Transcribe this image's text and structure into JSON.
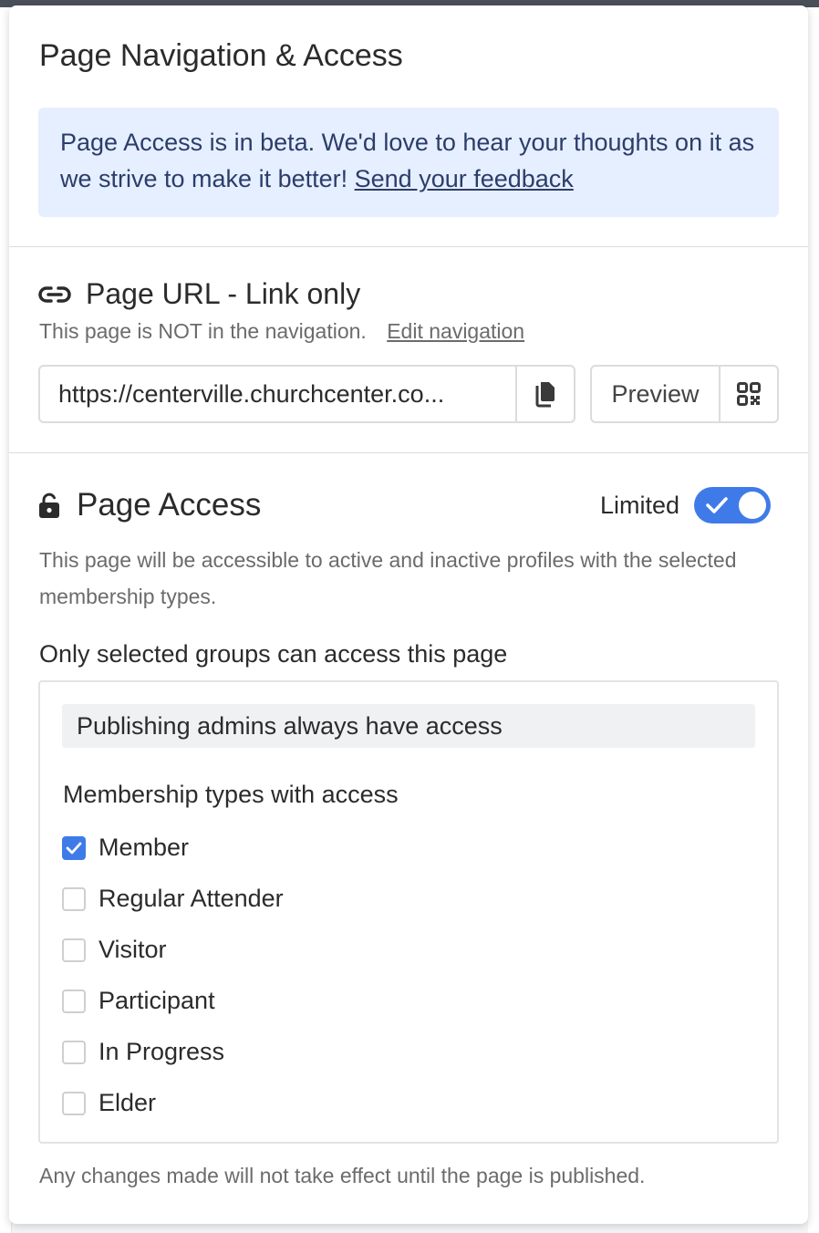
{
  "panel": {
    "title": "Page Navigation & Access",
    "beta_alert": {
      "text": "Page Access is in beta. We'd love to hear your thoughts on it as we strive to make it better!",
      "link": "Send your feedback"
    }
  },
  "page_url": {
    "title": "Page URL - Link only",
    "nav_note": "This page is NOT in the navigation.",
    "edit_nav_link": "Edit navigation",
    "url_value": "https://centerville.churchcenter.co...",
    "preview_label": "Preview"
  },
  "page_access": {
    "title": "Page Access",
    "toggle_label": "Limited",
    "toggle_on": true,
    "description": "This page will be accessible to active and inactive profiles with the selected membership types.",
    "groups_label": "Only selected groups can access this page",
    "admins_note": "Publishing admins always have access",
    "membership_title": "Membership types with access",
    "membership_types": [
      {
        "label": "Member",
        "checked": true
      },
      {
        "label": "Regular Attender",
        "checked": false
      },
      {
        "label": "Visitor",
        "checked": false
      },
      {
        "label": "Participant",
        "checked": false
      },
      {
        "label": "In Progress",
        "checked": false
      },
      {
        "label": "Elder",
        "checked": false
      }
    ]
  },
  "footer_note": "Any changes made will not take effect until the page is published.",
  "colors": {
    "accent": "#3f7be8",
    "alert_bg": "#e6efff",
    "alert_text": "#2b3d6b"
  },
  "icons": [
    "link-icon",
    "copy-icon",
    "qr-code-icon",
    "lock-open-icon",
    "check-icon"
  ]
}
